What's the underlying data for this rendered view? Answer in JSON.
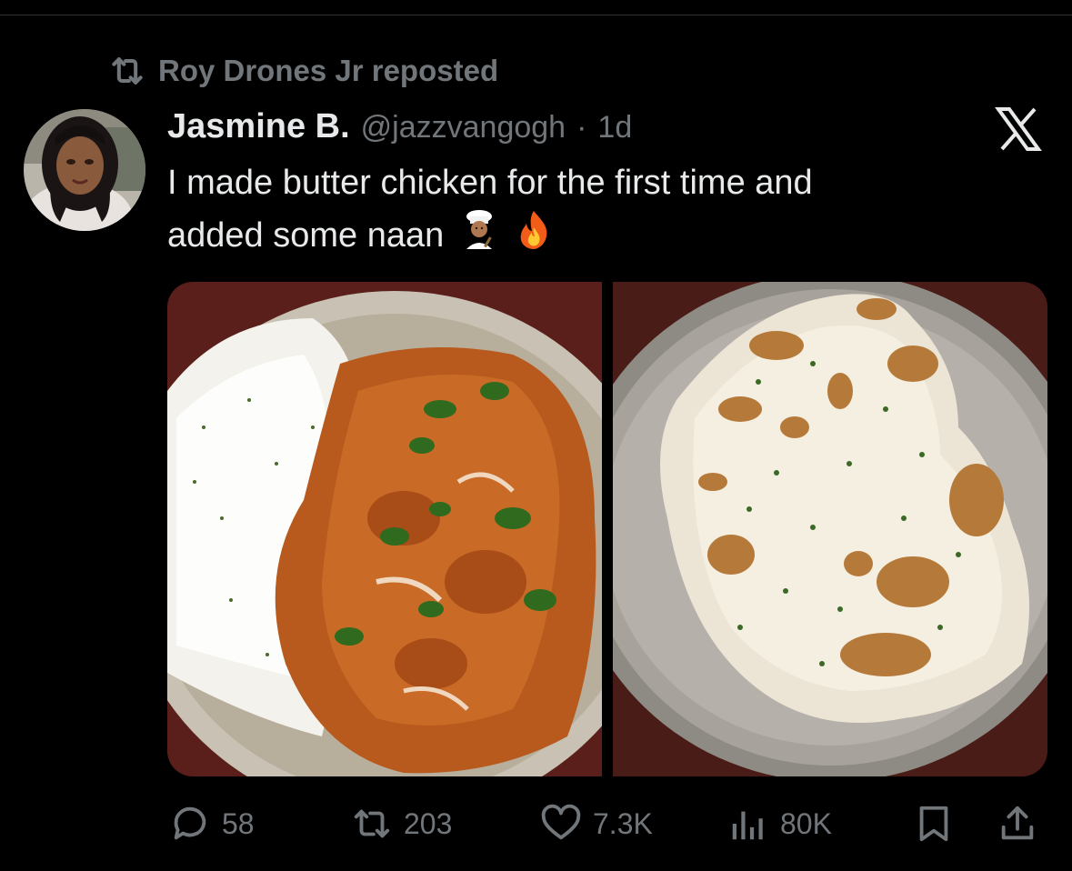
{
  "repost": {
    "text": "Roy Drones Jr reposted",
    "icon": "repost-icon"
  },
  "tweet": {
    "display_name": "Jasmine B.",
    "handle": "@jazzvangogh",
    "separator": "·",
    "time": "1d",
    "text_line1": "I made butter chicken for the first time and",
    "text_line2": "added some naan",
    "emojis": [
      "woman-cook-emoji",
      "fire-emoji"
    ]
  },
  "media": {
    "images": [
      "butter-chicken-with-rice-photo",
      "naan-bread-photo"
    ]
  },
  "actions": {
    "replies": "58",
    "reposts": "203",
    "likes": "7.3K",
    "views": "80K"
  },
  "colors": {
    "background": "#000000",
    "text_primary": "#e7e9ea",
    "text_secondary": "#71767b",
    "divider": "#2f3336"
  }
}
